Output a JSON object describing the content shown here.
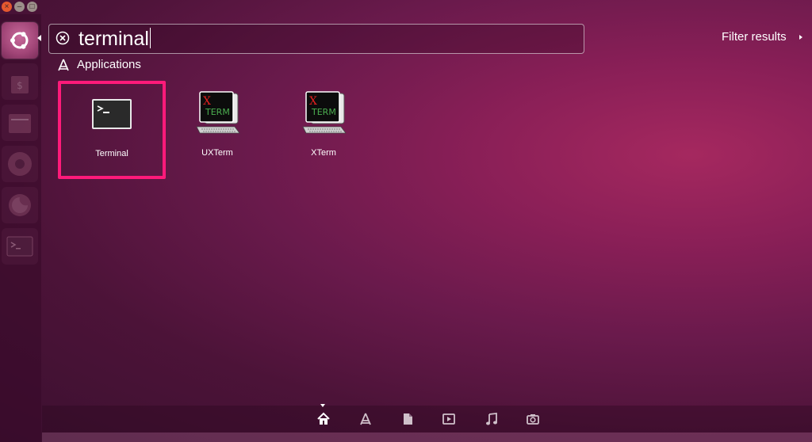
{
  "window_controls": {
    "close_glyph": "×",
    "minimize_glyph": "–",
    "maximize_glyph": "□"
  },
  "launcher": {
    "items": [
      {
        "name": "dash-home",
        "icon": "ubuntu-logo-icon",
        "state": "active"
      },
      {
        "name": "software-center",
        "icon": "shopping-bag-icon",
        "state": "dim"
      },
      {
        "name": "files",
        "icon": "file-cabinet-icon",
        "state": "dim"
      },
      {
        "name": "chromium",
        "icon": "chromium-icon",
        "state": "dim"
      },
      {
        "name": "firefox",
        "icon": "firefox-icon",
        "state": "dim"
      },
      {
        "name": "terminal",
        "icon": "terminal-icon",
        "state": "dim"
      }
    ]
  },
  "search": {
    "value": "terminal",
    "clear_icon": "clear-circle-icon"
  },
  "filter": {
    "label": "Filter results"
  },
  "category": {
    "title": "Applications",
    "icon": "applications-icon"
  },
  "apps": [
    {
      "label": "Terminal",
      "icon": "terminal-icon",
      "highlighted": true
    },
    {
      "label": "UXTerm",
      "icon": "xterm-icon",
      "highlighted": false
    },
    {
      "label": "XTerm",
      "icon": "xterm-icon",
      "highlighted": false
    }
  ],
  "xterm_icon_text": {
    "x": "X",
    "term": "TERM"
  },
  "colors": {
    "highlight_border": "#ff1a7a",
    "background": "#6a1a4c",
    "xterm_x": "#e02020"
  },
  "lenses": [
    {
      "name": "home",
      "icon": "home-icon",
      "active": true
    },
    {
      "name": "applications",
      "icon": "applications-icon",
      "active": false
    },
    {
      "name": "files",
      "icon": "document-icon",
      "active": false
    },
    {
      "name": "video",
      "icon": "video-icon",
      "active": false
    },
    {
      "name": "music",
      "icon": "music-note-icon",
      "active": false
    },
    {
      "name": "photos",
      "icon": "camera-icon",
      "active": false
    }
  ]
}
